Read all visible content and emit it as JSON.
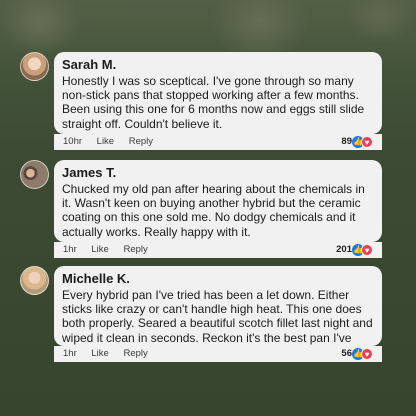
{
  "comments": [
    {
      "name": "Sarah M.",
      "text": "Honestly I was so sceptical. I've gone through so many non-stick pans that stopped working after a few months. Been using this one for 6 months now and eggs still slide straight off. Couldn't believe it.",
      "time": "10hr",
      "like_label": "Like",
      "reply_label": "Reply",
      "reaction_count": "89"
    },
    {
      "name": "James T.",
      "text": "Chucked my old pan after hearing about the chemicals in it. Wasn't keen on buying another hybrid but the ceramic coating on this one sold me. No dodgy chemicals and it actually works. Really happy with it.",
      "time": "1hr",
      "like_label": "Like",
      "reply_label": "Reply",
      "reaction_count": "201"
    },
    {
      "name": "Michelle K.",
      "text": "Every hybrid pan I've tried has been a let down. Either sticks like crazy or can't handle high heat. This one does both properly. Seared a beautiful scotch fillet last night and wiped it clean in seconds. Reckon it's the best pan I've owned.",
      "time": "1hr",
      "like_label": "Like",
      "reply_label": "Reply",
      "reaction_count": "56"
    }
  ],
  "colors": {
    "background": "#3c4a34",
    "bubble": "#f1f1f2",
    "like": "#1877f2",
    "love": "#f33e58"
  },
  "icons": {
    "like": "thumbs-up-icon",
    "love": "heart-icon"
  }
}
